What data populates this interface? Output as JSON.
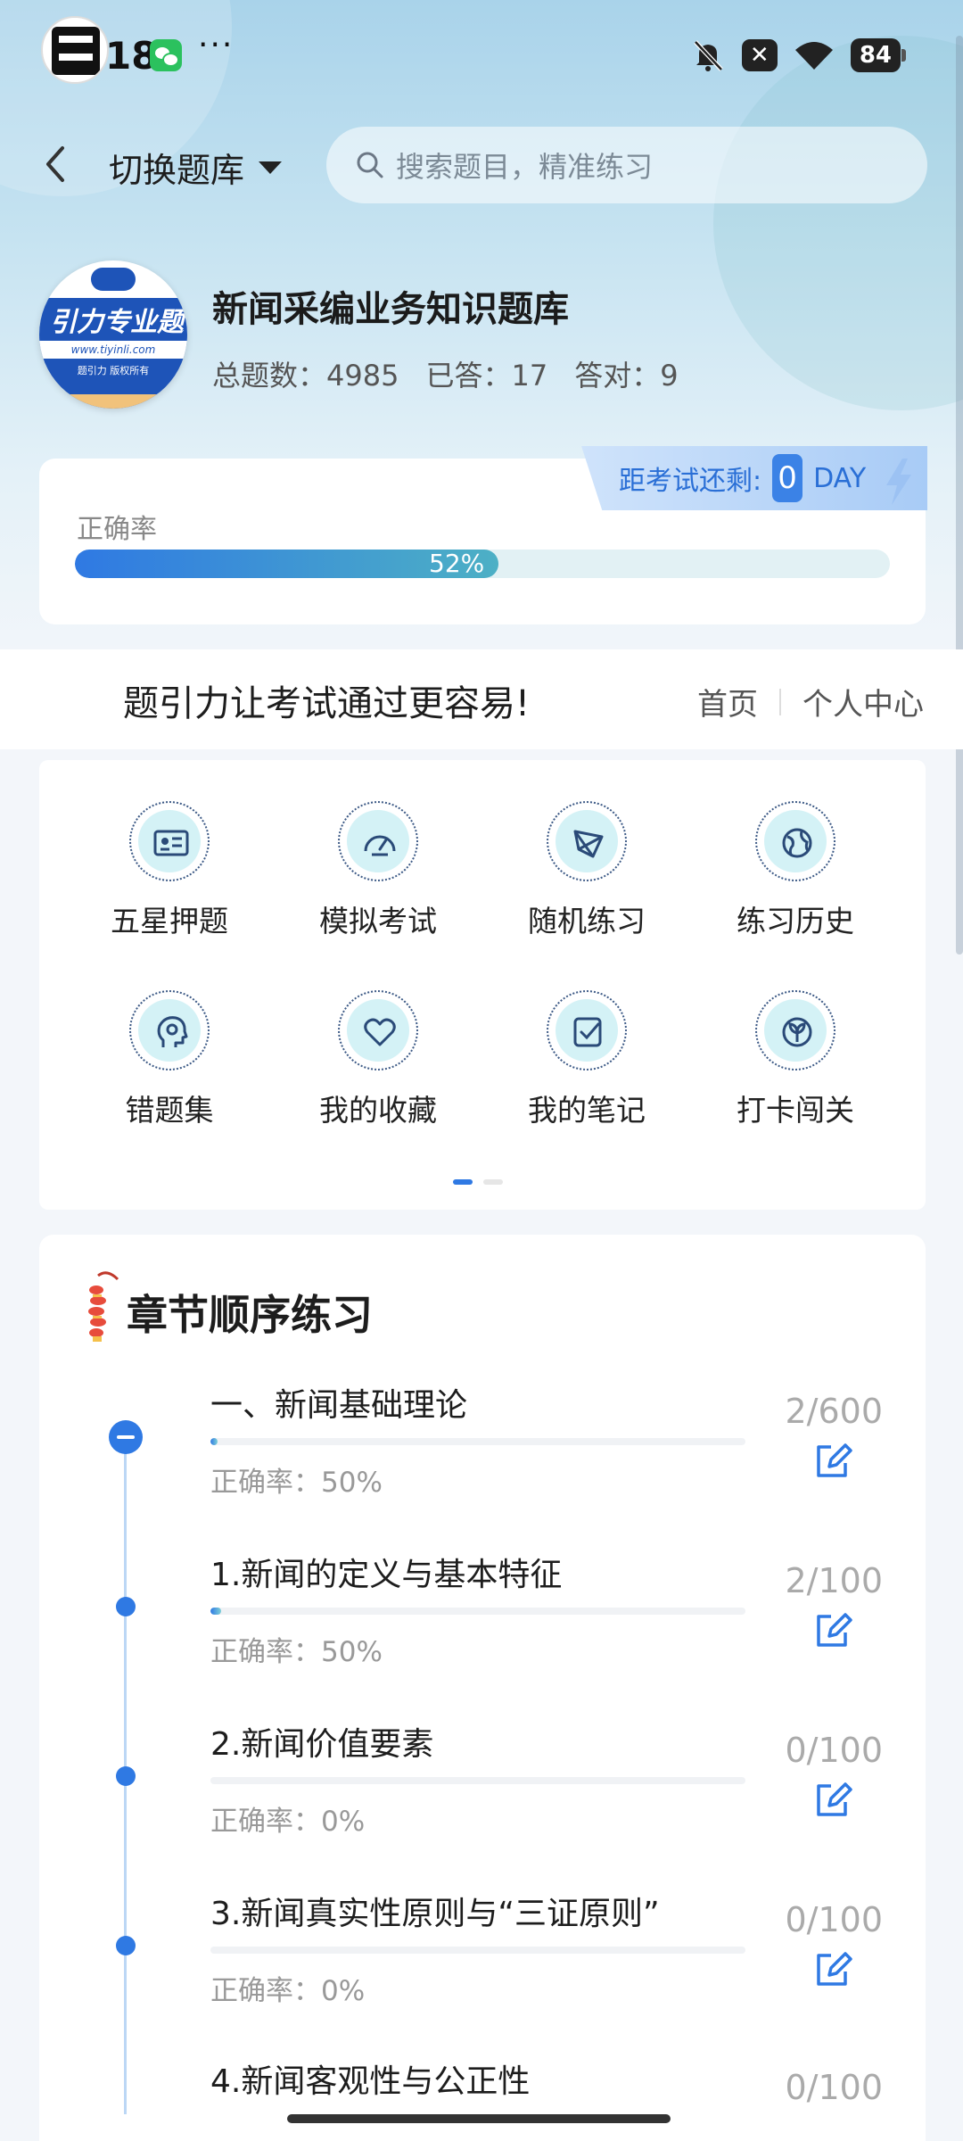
{
  "status_bar": {
    "time": "4:18",
    "dots": "···",
    "battery": "84",
    "x_badge": "✕"
  },
  "nav": {
    "switch_label": "切换题库",
    "search_placeholder": "搜索题目，精准练习"
  },
  "bank": {
    "title": "新闻采编业务知识题库",
    "stats": {
      "total": "总题数：4985",
      "answered": "已答：17",
      "correct": "答对：9"
    },
    "logo": {
      "main": "引力专业题",
      "url": "www.tiyinli.com",
      "sub": "题引力 版权所有"
    }
  },
  "accuracy": {
    "label": "正确率",
    "value": 0.52,
    "value_text": "52%",
    "countdown_label": "距考试还剩:",
    "countdown_num": "0",
    "countdown_unit": "DAY"
  },
  "banner": {
    "slogan": "题引力让考试通过更容易!",
    "home": "首页",
    "profile": "个人中心"
  },
  "menu": {
    "items": [
      {
        "label": "五星押题",
        "icon": "id-card-icon"
      },
      {
        "label": "模拟考试",
        "icon": "speedometer-icon"
      },
      {
        "label": "随机练习",
        "icon": "shuffle-icon"
      },
      {
        "label": "练习历史",
        "icon": "globe-icon"
      },
      {
        "label": "错题集",
        "icon": "head-icon"
      },
      {
        "label": "我的收藏",
        "icon": "heart-icon"
      },
      {
        "label": "我的笔记",
        "icon": "note-check-icon"
      },
      {
        "label": "打卡闯关",
        "icon": "sprout-icon"
      }
    ],
    "page": 1,
    "pages": 2
  },
  "chapters": {
    "title": "章节顺序练习",
    "items": [
      {
        "name": "一、新闻基础理论",
        "accuracy": "正确率：50%",
        "count": "2/600",
        "progress": 0.003
      },
      {
        "name": "1.新闻的定义与基本特征",
        "accuracy": "正确率：50%",
        "count": "2/100",
        "progress": 0.02
      },
      {
        "name": "2.新闻价值要素",
        "accuracy": "正确率：0%",
        "count": "0/100",
        "progress": 0
      },
      {
        "name": "3.新闻真实性原则与“三证原则”",
        "accuracy": "正确率：0%",
        "count": "0/100",
        "progress": 0
      },
      {
        "name": "4.新闻客观性与公正性",
        "accuracy": "",
        "count": "0/100",
        "progress": 0
      }
    ]
  },
  "colors": {
    "accent": "#2f79e3",
    "teal": "#4db0c5",
    "icon_bg": "#d4f2f6"
  }
}
